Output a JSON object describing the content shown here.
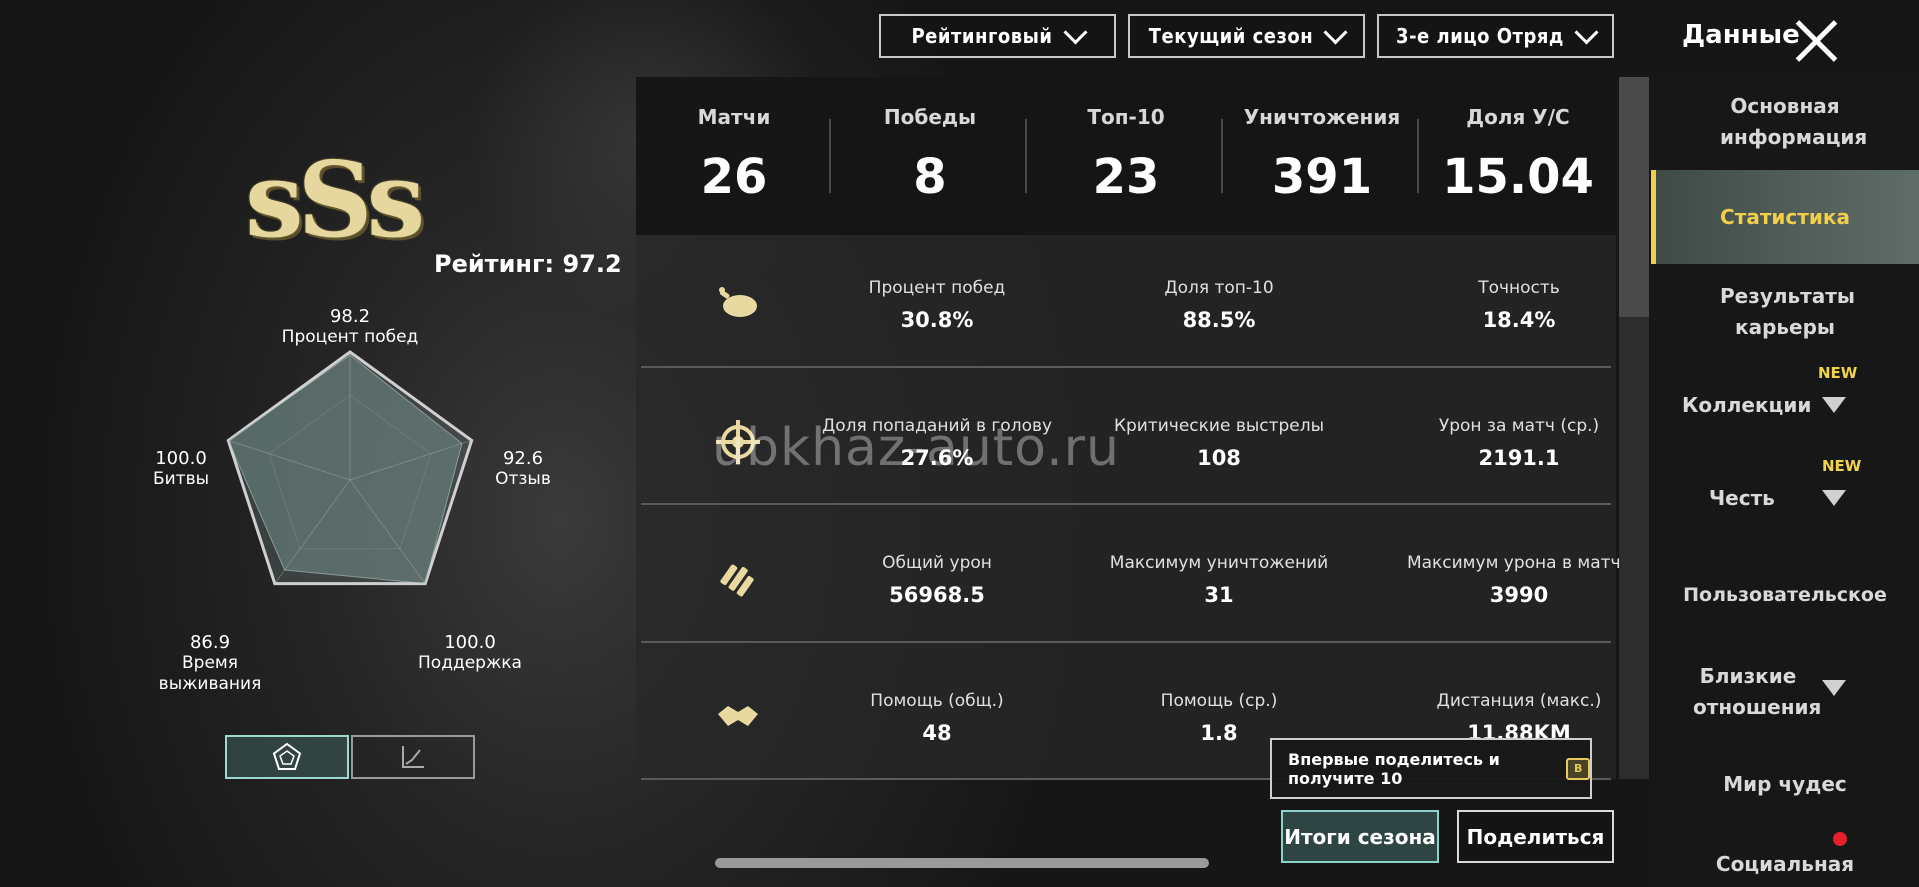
{
  "filters": {
    "mode": "Рейтинговый",
    "season": "Текущий сезон",
    "perspective": "3-е лицо Отряд"
  },
  "header": {
    "title": "Данные"
  },
  "profile": {
    "rank_tier": "sSs",
    "rating_text": "Рейтинг: 97.2"
  },
  "radar": {
    "axes": [
      {
        "value": "98.2",
        "label": "Процент побед"
      },
      {
        "value": "92.6",
        "label": "Отзыв"
      },
      {
        "value": "100.0",
        "label": "Поддержка"
      },
      {
        "value": "86.9",
        "label": "Время выживания"
      },
      {
        "value": "100.0",
        "label": "Битвы"
      }
    ]
  },
  "summary": [
    {
      "label": "Матчи",
      "value": "26"
    },
    {
      "label": "Победы",
      "value": "8"
    },
    {
      "label": "Топ-10",
      "value": "23"
    },
    {
      "label": "Уничтожения",
      "value": "391"
    },
    {
      "label": "Доля У/С",
      "value": "15.04"
    }
  ],
  "detail_rows": [
    {
      "icon": "chicken-icon",
      "cells": [
        {
          "label": "Процент побед",
          "value": "30.8%"
        },
        {
          "label": "Доля топ-10",
          "value": "88.5%"
        },
        {
          "label": "Точность",
          "value": "18.4%"
        }
      ]
    },
    {
      "icon": "crosshair-icon",
      "cells": [
        {
          "label": "Доля попаданий в голову",
          "value": "27.6%"
        },
        {
          "label": "Критические выстрелы",
          "value": "108"
        },
        {
          "label": "Урон за матч (ср.)",
          "value": "2191.1"
        }
      ]
    },
    {
      "icon": "bullets-icon",
      "cells": [
        {
          "label": "Общий урон",
          "value": "56968.5"
        },
        {
          "label": "Максимум уничтожений",
          "value": "31"
        },
        {
          "label": "Максимум урона в матче",
          "value": "3990"
        }
      ]
    },
    {
      "icon": "handshake-icon",
      "cells": [
        {
          "label": "Помощь (общ.)",
          "value": "48"
        },
        {
          "label": "Помощь (ср.)",
          "value": "1.8"
        },
        {
          "label": "Дистанция (макс.)",
          "value": "11.88KM"
        }
      ]
    }
  ],
  "sidebar": {
    "items": [
      {
        "label": "Основная информация"
      },
      {
        "label": "Статистика",
        "active": true
      },
      {
        "label": "Результаты карьеры"
      },
      {
        "label": "Коллекции",
        "badge": "NEW"
      },
      {
        "label": "Честь",
        "badge": "NEW"
      },
      {
        "label": "Пользовательское"
      },
      {
        "label": "Близкие отношения"
      },
      {
        "label": "Мир чудес"
      },
      {
        "label": "Социальная"
      }
    ]
  },
  "share_tip": "Впервые поделитесь и получите 10",
  "buttons": {
    "season_results": "Итоги сезона",
    "share": "Поделиться"
  },
  "watermark": "ubkhaz-auto.ru",
  "colors": {
    "accent_teal": "#8ad3c8",
    "accent_gold": "#f2cf4a",
    "rank_gold": "#e6d79e"
  }
}
